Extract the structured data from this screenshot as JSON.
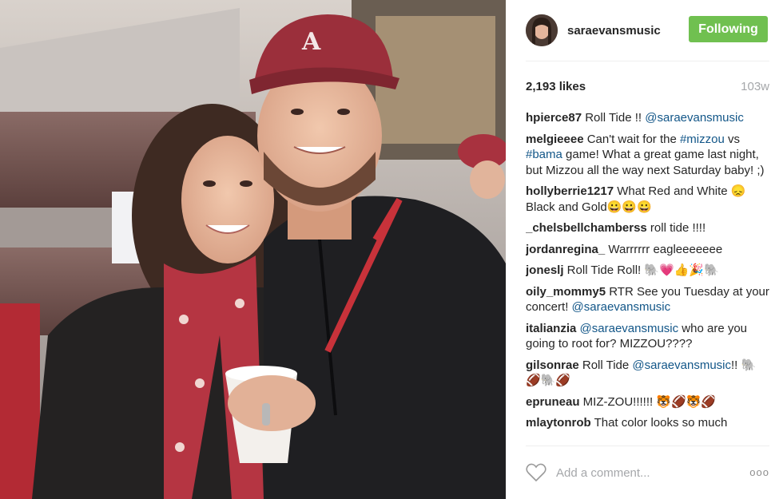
{
  "header": {
    "username": "saraevansmusic",
    "follow_label": "Following"
  },
  "meta": {
    "likes": "2,193 likes",
    "age": "103w"
  },
  "comments": [
    {
      "user": "hpierce87",
      "parts": [
        {
          "t": " Roll Tide !! "
        },
        {
          "m": "@saraevansmusic"
        }
      ]
    },
    {
      "user": "melgieeee",
      "parts": [
        {
          "t": " Can't wait for the "
        },
        {
          "m": "#mizzou"
        },
        {
          "t": " vs "
        },
        {
          "m": "#bama"
        },
        {
          "t": " game! What a great game last night, but Mizzou all the way next Saturday baby! ;)"
        }
      ]
    },
    {
      "user": "hollyberrie1217",
      "parts": [
        {
          "t": " What Red and White 😞 Black and Gold😀😀😀"
        }
      ]
    },
    {
      "user": "_chelsbellchamberss",
      "parts": [
        {
          "t": " roll tide !!!!"
        }
      ]
    },
    {
      "user": "jordanregina_",
      "parts": [
        {
          "t": " Warrrrrr eagleeeeeee"
        }
      ]
    },
    {
      "user": "joneslj",
      "parts": [
        {
          "t": " Roll Tide Roll! 🐘💗👍🎉🐘"
        }
      ]
    },
    {
      "user": "oily_mommy5",
      "parts": [
        {
          "t": " RTR See you Tuesday at your concert! "
        },
        {
          "m": "@saraevansmusic"
        }
      ]
    },
    {
      "user": "italianzia",
      "parts": [
        {
          "t": " "
        },
        {
          "m": "@saraevansmusic"
        },
        {
          "t": " who are you going to root for? MIZZOU????"
        }
      ]
    },
    {
      "user": "gilsonrae",
      "parts": [
        {
          "t": " Roll Tide "
        },
        {
          "m": "@saraevansmusic"
        },
        {
          "t": "!! 🐘🏈🐘🏈"
        }
      ]
    },
    {
      "user": "epruneau",
      "parts": [
        {
          "t": " MIZ-ZOU!!!!!! 🐯🏈🐯🏈"
        }
      ]
    },
    {
      "user": "mlaytonrob",
      "parts": [
        {
          "t": " That color looks so much"
        }
      ]
    }
  ],
  "footer": {
    "comment_placeholder": "Add a comment...",
    "more_label": "ooo"
  },
  "icons": {
    "heart": "heart-outline-icon",
    "more": "ellipsis-icon"
  },
  "colors": {
    "follow_button": "#70c050",
    "mention": "#125688",
    "muted": "#a5a7aa"
  }
}
